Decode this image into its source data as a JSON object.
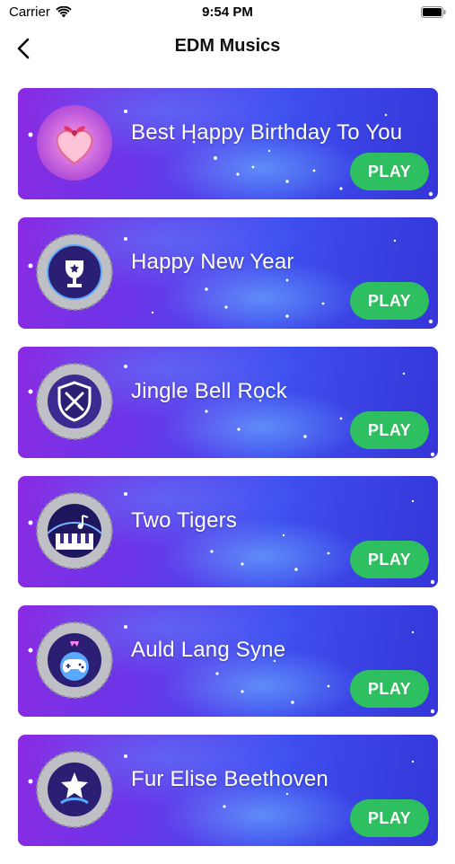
{
  "status_bar": {
    "carrier": "Carrier",
    "time": "9:54 PM"
  },
  "nav": {
    "title": "EDM Musics",
    "back_icon": "chevron-left-icon"
  },
  "colors": {
    "play_button": "#2ec060",
    "card_start": "#8a2be2",
    "card_end": "#3535d8"
  },
  "songs": [
    {
      "title": "Best Happy Birthday To You",
      "play_label": "PLAY",
      "icon": "gift-heart-icon"
    },
    {
      "title": "Happy New Year",
      "play_label": "PLAY",
      "icon": "trophy-badge-icon"
    },
    {
      "title": "Jingle Bell Rock",
      "play_label": "PLAY",
      "icon": "shield-swords-badge-icon"
    },
    {
      "title": "Two Tigers",
      "play_label": "PLAY",
      "icon": "piano-badge-icon"
    },
    {
      "title": "Auld Lang Syne",
      "play_label": "PLAY",
      "icon": "gamepad-badge-icon"
    },
    {
      "title": "Fur Elise Beethoven",
      "play_label": "PLAY",
      "icon": "star-badge-icon"
    }
  ]
}
